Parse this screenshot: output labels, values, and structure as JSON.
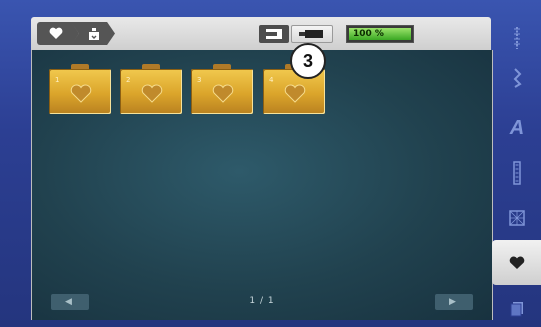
{
  "breadcrumb": {
    "items": [
      {
        "icon": "heart-icon"
      },
      {
        "icon": "embroidery-hoop-icon"
      }
    ]
  },
  "toolbar": {
    "machine_icon": "machine-icon",
    "usb_icon": "usb-stick-icon",
    "capacity_label": "100 %",
    "capacity_fraction": 1.0
  },
  "folders": [
    {
      "number": "1",
      "icon": "heart-icon"
    },
    {
      "number": "2",
      "icon": "heart-icon"
    },
    {
      "number": "3",
      "icon": "heart-icon"
    },
    {
      "number": "4",
      "icon": "heart-icon"
    }
  ],
  "pager": {
    "prev_label": "◀",
    "next_label": "▶",
    "page_text": "1 / 1"
  },
  "rail": {
    "items": [
      {
        "icon": "stitch-straight-icon"
      },
      {
        "icon": "stitch-zigzag-icon"
      },
      {
        "icon": "alphabet-icon",
        "label": "A"
      },
      {
        "icon": "buttonhole-icon"
      },
      {
        "icon": "quilt-icon"
      },
      {
        "icon": "personal-program-icon",
        "active": true
      },
      {
        "icon": "memory-icon"
      }
    ]
  },
  "callout": {
    "text": "3"
  },
  "colors": {
    "frame": "#2c3f93",
    "panel": "#21424f",
    "folder": "#dba52b",
    "battery": "#3aa823"
  }
}
